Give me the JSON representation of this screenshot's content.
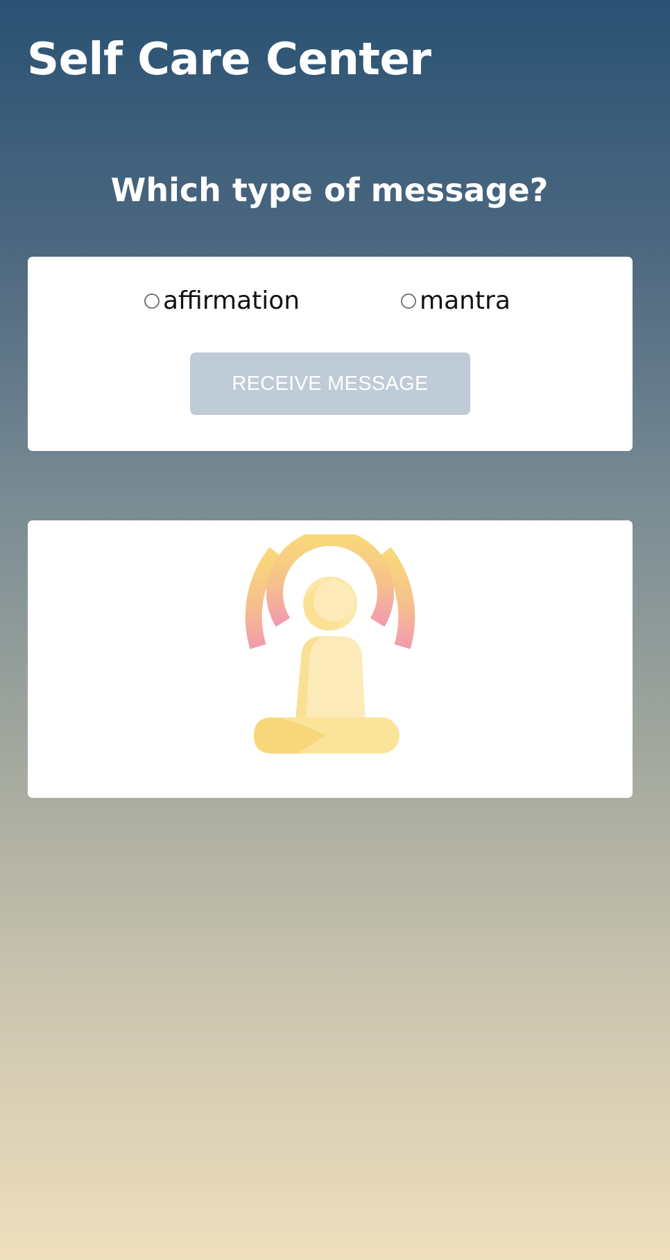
{
  "header": {
    "title": "Self Care Center"
  },
  "prompt": {
    "question": "Which type of message?"
  },
  "form": {
    "options": [
      {
        "label": "affirmation",
        "selected": false
      },
      {
        "label": "mantra",
        "selected": false
      }
    ],
    "button_label": "RECEIVE MESSAGE"
  },
  "image": {
    "icon": "meditation-icon"
  },
  "colors": {
    "gradient_top": "#2a5273",
    "gradient_bottom": "#efdfbd",
    "button_bg": "#bfcbd6",
    "card_bg": "#ffffff",
    "icon_yellow": "#f8dc7c",
    "icon_pink": "#f19cad"
  }
}
